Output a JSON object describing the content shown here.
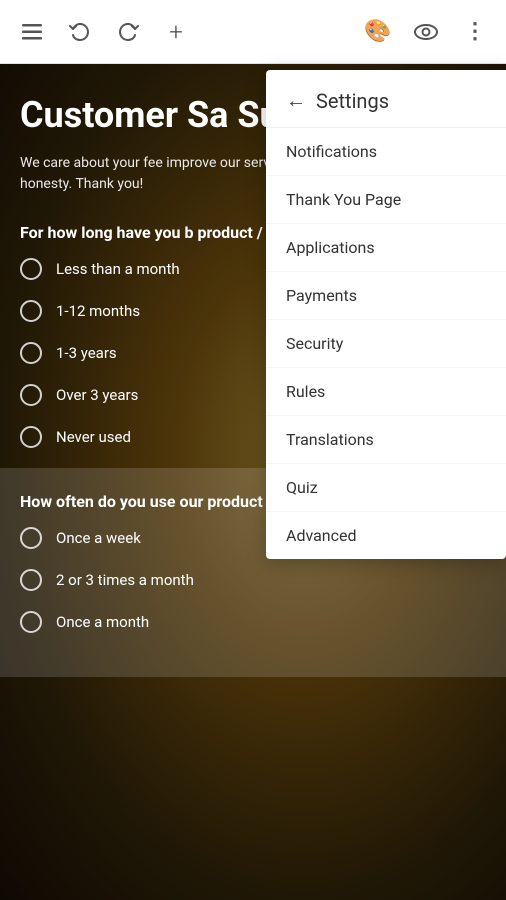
{
  "toolbar": {
    "menu_icon": "☰",
    "undo_icon": "↺",
    "redo_icon": "↻",
    "add_icon": "+",
    "palette_icon": "🎨",
    "preview_icon": "👁",
    "more_icon": "⋮"
  },
  "survey": {
    "title": "Customer Sa Survey",
    "description": "We care about your fee improve our services in a satisfactory to you. We a honesty. Thank you!",
    "question1": "For how long have you b product / service?",
    "options1": [
      "Less than a month",
      "1-12 months",
      "1-3 years",
      "Over 3 years",
      "Never used"
    ],
    "question2": "How often do you use our product / service?",
    "options2": [
      "Once a week",
      "2 or 3 times a month",
      "Once a month"
    ]
  },
  "settings": {
    "title": "Settings",
    "back_label": "←",
    "menu_items": [
      {
        "id": "notifications",
        "label": "Notifications"
      },
      {
        "id": "thank-you-page",
        "label": "Thank You Page"
      },
      {
        "id": "applications",
        "label": "Applications"
      },
      {
        "id": "payments",
        "label": "Payments"
      },
      {
        "id": "security",
        "label": "Security"
      },
      {
        "id": "rules",
        "label": "Rules"
      },
      {
        "id": "translations",
        "label": "Translations"
      },
      {
        "id": "quiz",
        "label": "Quiz"
      },
      {
        "id": "advanced",
        "label": "Advanced"
      }
    ]
  }
}
